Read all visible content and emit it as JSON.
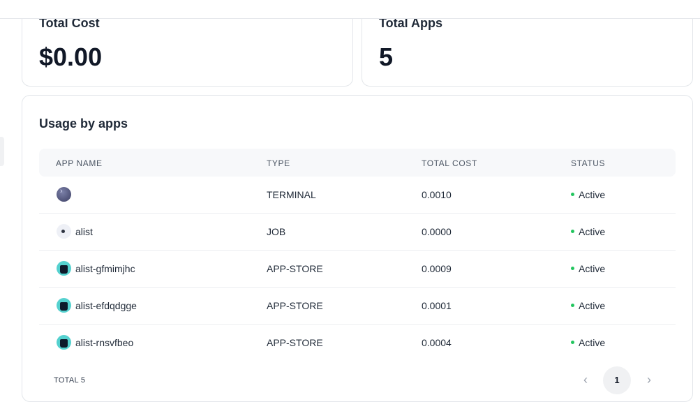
{
  "stats": {
    "cost": {
      "label": "Total Cost",
      "value": "$0.00"
    },
    "apps": {
      "label": "Total Apps",
      "value": "5"
    }
  },
  "usage": {
    "title": "Usage by apps",
    "columns": [
      "APP NAME",
      "TYPE",
      "TOTAL COST",
      "STATUS"
    ],
    "rows": [
      {
        "icon": "terminal-icon",
        "name": "",
        "type": "TERMINAL",
        "cost": "0.0010",
        "status": "Active"
      },
      {
        "icon": "job-icon",
        "name": "alist",
        "type": "JOB",
        "cost": "0.0000",
        "status": "Active"
      },
      {
        "icon": "app-store-icon",
        "name": "alist-gfmimjhc",
        "type": "APP-STORE",
        "cost": "0.0009",
        "status": "Active"
      },
      {
        "icon": "app-store-icon",
        "name": "alist-efdqdgge",
        "type": "APP-STORE",
        "cost": "0.0001",
        "status": "Active"
      },
      {
        "icon": "app-store-icon",
        "name": "alist-rnsvfbeo",
        "type": "APP-STORE",
        "cost": "0.0004",
        "status": "Active"
      }
    ],
    "total_label": "TOTAL 5",
    "pagination": {
      "current_page": "1",
      "prev_icon": "chevron-left-icon",
      "next_icon": "chevron-right-icon"
    }
  },
  "colors": {
    "status_active": "#22c55e",
    "app_store_icon": "#55d1cf"
  }
}
